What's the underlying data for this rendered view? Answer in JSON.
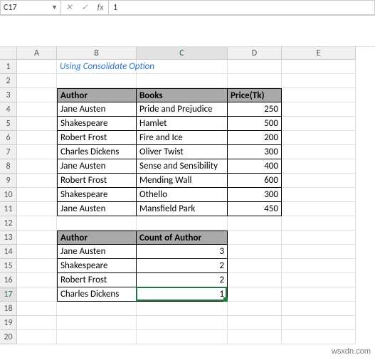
{
  "name_box": "C17",
  "formula": "1",
  "columns": [
    "A",
    "B",
    "C",
    "D",
    "E"
  ],
  "rows": [
    "1",
    "2",
    "3",
    "4",
    "5",
    "6",
    "7",
    "8",
    "9",
    "10",
    "11",
    "12",
    "13",
    "14",
    "15",
    "16",
    "17",
    "18",
    "19",
    "20"
  ],
  "title": "Using Consolidate Option",
  "table1": {
    "headers": [
      "Author",
      "Books",
      "Price(Tk)"
    ],
    "rows": [
      [
        "Jane Austen",
        "Pride and Prejudice",
        "250"
      ],
      [
        "Shakespeare",
        "Hamlet",
        "500"
      ],
      [
        "Robert Frost",
        "Fire and Ice",
        "200"
      ],
      [
        "Charles Dickens",
        "Oliver Twist",
        "300"
      ],
      [
        "Jane Austen",
        "Sense and Sensibility",
        "400"
      ],
      [
        "Robert Frost",
        "Mending Wall",
        "600"
      ],
      [
        "Shakespeare",
        "Othello",
        "300"
      ],
      [
        "Jane Austen",
        "Mansfield Park",
        "450"
      ]
    ]
  },
  "table2": {
    "headers": [
      "Author",
      "Count of Author"
    ],
    "rows": [
      [
        "Jane Austen",
        "3"
      ],
      [
        "Shakespeare",
        "2"
      ],
      [
        "Robert Frost",
        "2"
      ],
      [
        "Charles Dickens",
        "1"
      ]
    ]
  },
  "watermark": "wsxdn.com",
  "fx_label": "fx",
  "chart_data": [
    {
      "type": "table",
      "title": "Using Consolidate Option",
      "columns": [
        "Author",
        "Books",
        "Price(Tk)"
      ],
      "data": [
        [
          "Jane Austen",
          "Pride and Prejudice",
          250
        ],
        [
          "Shakespeare",
          "Hamlet",
          500
        ],
        [
          "Robert Frost",
          "Fire and Ice",
          200
        ],
        [
          "Charles Dickens",
          "Oliver Twist",
          300
        ],
        [
          "Jane Austen",
          "Sense and Sensibility",
          400
        ],
        [
          "Robert Frost",
          "Mending Wall",
          600
        ],
        [
          "Shakespeare",
          "Othello",
          300
        ],
        [
          "Jane Austen",
          "Mansfield Park",
          450
        ]
      ]
    },
    {
      "type": "table",
      "columns": [
        "Author",
        "Count of Author"
      ],
      "data": [
        [
          "Jane Austen",
          3
        ],
        [
          "Shakespeare",
          2
        ],
        [
          "Robert Frost",
          2
        ],
        [
          "Charles Dickens",
          1
        ]
      ]
    }
  ]
}
